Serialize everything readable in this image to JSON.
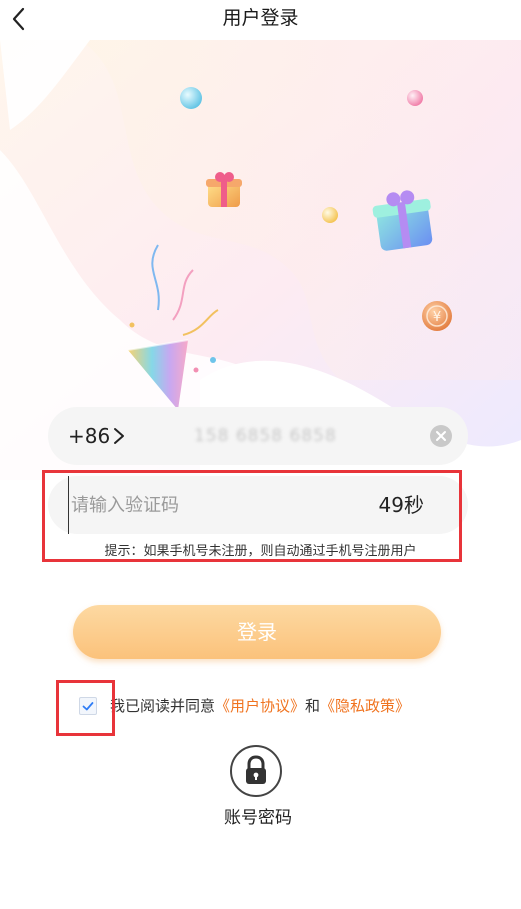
{
  "header": {
    "title": "用户登录",
    "back_icon": "chevron-left-icon"
  },
  "banner": {
    "decorations": [
      "gift-box-icon",
      "party-popper-icon",
      "coin-icon",
      "balloon-icon"
    ]
  },
  "phone": {
    "country_code": "+86",
    "value_masked": "158 6858 6858",
    "clear_icon": "clear-circle-icon"
  },
  "code": {
    "placeholder": "请输入验证码",
    "countdown": "49秒"
  },
  "hint": "提示：如果手机号未注册，则自动通过手机号注册用户",
  "login_button": "登录",
  "agreement": {
    "prefix": "我已阅读并同意",
    "user_agreement": "《用户协议》",
    "and": "和",
    "privacy_policy": "《隐私政策》",
    "checked": true
  },
  "password_login": {
    "label": "账号密码",
    "icon": "lock-icon"
  },
  "colors": {
    "accent": "#f0731f",
    "button_top": "#fdd9a2",
    "button_bottom": "#fbc27b",
    "highlight": "#e8343a",
    "field_bg": "#f5f5f5"
  }
}
